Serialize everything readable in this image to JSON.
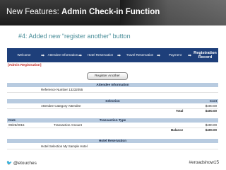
{
  "slide": {
    "title_prefix": "New Features: ",
    "title_bold": "Admin Check-in Function",
    "subtitle": "#4: Added new “register another” button"
  },
  "steps": {
    "items": [
      {
        "label": "Welcome"
      },
      {
        "label": "Attendee Information"
      },
      {
        "label": "Hotel Reservation"
      },
      {
        "label": "Travel Reservation"
      },
      {
        "label": "Payment"
      },
      {
        "label": "Registration Record"
      }
    ],
    "arrow_icon": "right-arrow-icon"
  },
  "form": {
    "admin_label": "[Admin Registration]",
    "register_another": "Register Another",
    "attendee_header": "Attendee Information",
    "reference": "Reference Number 13232055",
    "selection_header": "Selection",
    "cost_header": "Cost",
    "category": "Attendee Category Attendee",
    "category_cost": "$400.00",
    "total_label": "Total",
    "total_value": "$400.00",
    "date_header": "Date",
    "transaction_header": "Transaction Type",
    "tx_date": "09/26/2015",
    "tx_type": "Transaction Amount",
    "tx_amount": "$400.00",
    "balance_label": "Balance",
    "balance_value": "$400.00",
    "hotel_header": "Hotel Reservation",
    "hotel_selection": "Hotel Selection My Sample Hotel"
  },
  "footer": {
    "handle": "@etouches",
    "hashtag": "#eroadshow15",
    "bird_icon": "twitter-bird-icon"
  },
  "colors": {
    "header_bg": "#2a2a2a",
    "step_bar": "#1e3f7a",
    "section_bar": "#b8cbe0",
    "subtitle": "#4a8e99",
    "admin_red": "#c0221f"
  }
}
